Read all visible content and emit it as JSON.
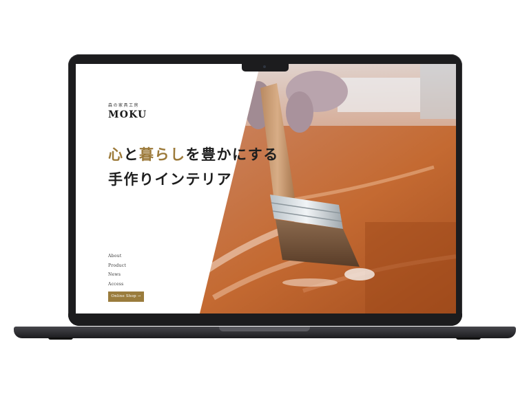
{
  "site": {
    "subtitle": "森の家具工房",
    "brand": "MOKU"
  },
  "hero": {
    "line1_accent_a": "心",
    "line1_mid": "と",
    "line1_accent_b": "暮らし",
    "line1_rest": "を豊かにする",
    "line2": "手作りインテリア"
  },
  "nav": {
    "items": [
      "About",
      "Product",
      "News",
      "Access"
    ]
  },
  "cta": {
    "label": "Online Shop →"
  },
  "colors": {
    "accent": "#9c7a3a",
    "button": "#9a7c3c",
    "text": "#1e1e1e"
  },
  "image": {
    "subject": "paintbrush-varnishing-wood-photo"
  }
}
